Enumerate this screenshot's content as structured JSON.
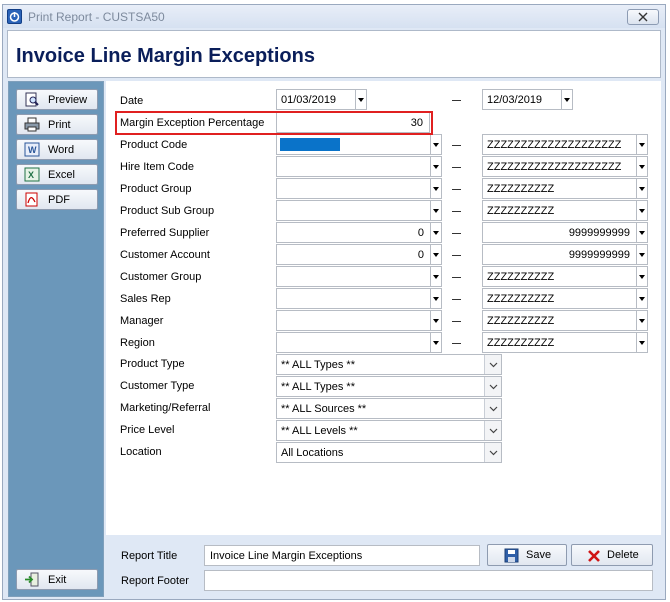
{
  "window": {
    "title": "Print Report - CUSTSA50"
  },
  "header": {
    "title": "Invoice Line Margin Exceptions"
  },
  "sidebar": {
    "buttons": [
      {
        "label": "Preview",
        "icon": "preview-icon"
      },
      {
        "label": "Print",
        "icon": "printer-icon"
      },
      {
        "label": "Word",
        "icon": "word-icon"
      },
      {
        "label": "Excel",
        "icon": "excel-icon"
      },
      {
        "label": "PDF",
        "icon": "pdf-icon"
      }
    ],
    "exit_label": "Exit"
  },
  "form": {
    "date": {
      "label": "Date",
      "from": "01/03/2019",
      "to": "12/03/2019"
    },
    "margin": {
      "label": "Margin Exception Percentage",
      "value": "30"
    },
    "product_code": {
      "label": "Product Code",
      "to": "ZZZZZZZZZZZZZZZZZZZZ"
    },
    "hire_item_code": {
      "label": "Hire Item Code",
      "to": "ZZZZZZZZZZZZZZZZZZZZ"
    },
    "product_group": {
      "label": "Product Group",
      "to": "ZZZZZZZZZZ"
    },
    "product_sub_group": {
      "label": "Product Sub Group",
      "to": "ZZZZZZZZZZ"
    },
    "preferred_supplier": {
      "label": "Preferred Supplier",
      "from": "0",
      "to": "9999999999"
    },
    "customer_account": {
      "label": "Customer Account",
      "from": "0",
      "to": "9999999999"
    },
    "customer_group": {
      "label": "Customer Group",
      "to": "ZZZZZZZZZZ"
    },
    "sales_rep": {
      "label": "Sales Rep",
      "to": "ZZZZZZZZZZ"
    },
    "manager": {
      "label": "Manager",
      "to": "ZZZZZZZZZZ"
    },
    "region": {
      "label": "Region",
      "to": "ZZZZZZZZZZ"
    },
    "product_type": {
      "label": "Product Type",
      "value": "** ALL Types **"
    },
    "customer_type": {
      "label": "Customer Type",
      "value": "** ALL Types **"
    },
    "marketing": {
      "label": "Marketing/Referral",
      "value": "** ALL Sources **"
    },
    "price_level": {
      "label": "Price Level",
      "value": "** ALL Levels **"
    },
    "location": {
      "label": "Location",
      "value": "All Locations"
    }
  },
  "footer": {
    "report_title_label": "Report Title",
    "report_title_value": "Invoice Line Margin Exceptions",
    "report_footer_label": "Report Footer",
    "report_footer_value": "",
    "save_label": "Save",
    "delete_label": "Delete"
  },
  "colors": {
    "sidebar": "#6b97ba",
    "highlight": "#e02020",
    "title": "#0a1e5a"
  }
}
